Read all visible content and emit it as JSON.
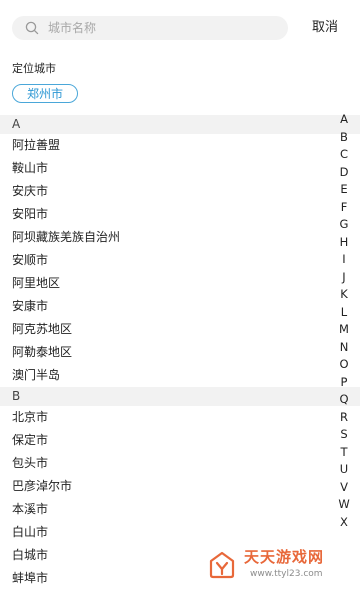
{
  "search": {
    "placeholder": "城市名称",
    "cancel_label": "取消"
  },
  "location": {
    "title": "定位城市",
    "current_city": "郑州市"
  },
  "sections": [
    {
      "letter": "A",
      "cities": [
        "阿拉善盟",
        "鞍山市",
        "安庆市",
        "安阳市",
        "阿坝藏族羌族自治州",
        "安顺市",
        "阿里地区",
        "安康市",
        "阿克苏地区",
        "阿勒泰地区",
        "澳门半岛"
      ]
    },
    {
      "letter": "B",
      "cities": [
        "北京市",
        "保定市",
        "包头市",
        "巴彦淖尔市",
        "本溪市",
        "白山市",
        "白城市",
        "蚌埠市"
      ]
    }
  ],
  "index_letters": [
    "A",
    "B",
    "C",
    "D",
    "E",
    "F",
    "G",
    "H",
    "I",
    "J",
    "K",
    "L",
    "M",
    "N",
    "O",
    "P",
    "Q",
    "R",
    "S",
    "T",
    "U",
    "V",
    "W",
    "X"
  ],
  "watermark": {
    "brand": "天天游戏网",
    "url": "www.ttyl23.com"
  },
  "colors": {
    "accent": "#2c97d3",
    "section_bg": "#f2f2f2",
    "search_bg": "#f2f2f2",
    "watermark": "#e8683a"
  },
  "icons": {
    "search": "search-icon"
  }
}
